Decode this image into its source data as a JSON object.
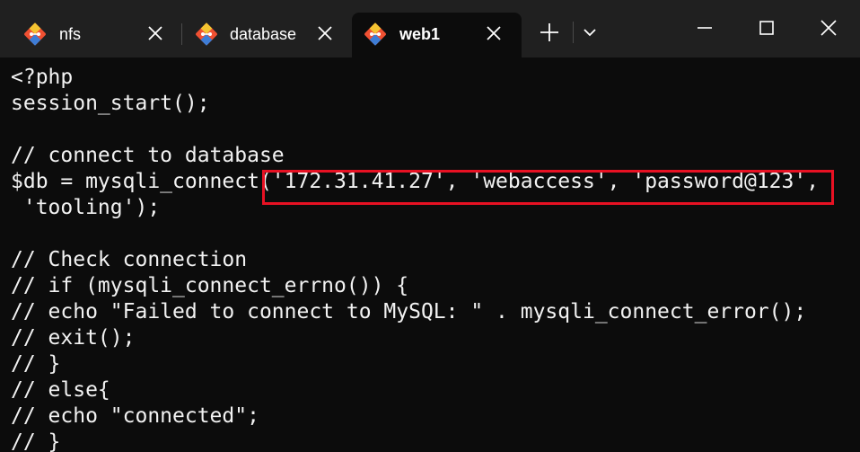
{
  "tabs": [
    {
      "label": "nfs",
      "active": false,
      "icon": "git-bash-icon"
    },
    {
      "label": "database",
      "active": false,
      "icon": "git-bash-icon"
    },
    {
      "label": "web1",
      "active": true,
      "icon": "git-bash-icon"
    }
  ],
  "toolbar": {
    "new_tab_icon": "plus-icon",
    "dropdown_icon": "chevron-down-icon"
  },
  "window_controls": {
    "minimize_icon": "minimize-icon",
    "maximize_icon": "maximize-icon",
    "close_icon": "close-icon"
  },
  "terminal": {
    "lines": [
      "<?php",
      "session_start();",
      "",
      "// connect to database",
      "$db = mysqli_connect('172.31.41.27', 'webaccess', 'password@123',",
      " 'tooling');",
      "",
      "// Check connection",
      "// if (mysqli_connect_errno()) {",
      "// echo \"Failed to connect to MySQL: \" . mysqli_connect_error();",
      "// exit();",
      "// }",
      "// else{",
      "// echo \"connected\";",
      "// }"
    ]
  },
  "colors": {
    "titlebar_bg": "#202020",
    "terminal_bg": "#0c0c0c",
    "terminal_fg": "#f2f2f2",
    "highlight": "#e81123"
  }
}
